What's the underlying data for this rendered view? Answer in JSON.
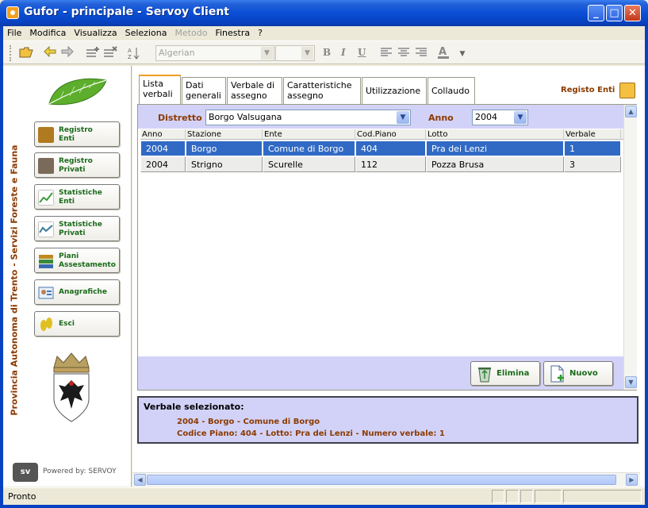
{
  "window": {
    "title": "Gufor - principale - Servoy Client",
    "min": "_",
    "max": "□",
    "close": "✕"
  },
  "menu": [
    "File",
    "Modifica",
    "Visualizza",
    "Seleziona",
    "Metodo",
    "Finestra",
    "?"
  ],
  "menu_disabled": [
    "Metodo"
  ],
  "toolbar": {
    "font_name": "Algerian",
    "bold": "B",
    "italic": "I",
    "underline": "U",
    "icons": [
      "open-folder-icon",
      "back-arrow-icon",
      "forward-arrow-icon",
      "add-record-icon",
      "delete-record-icon",
      "sort-icon"
    ]
  },
  "sidebar": {
    "org": "Provincia Autonoma di Trento - Servizi Foreste e Fauna",
    "items": [
      {
        "label": "Registro\nEnti",
        "l1": "Registro",
        "l2": "Enti",
        "color": "#b07a20"
      },
      {
        "label": "Registro\nPrivati",
        "l1": "Registro",
        "l2": "Privati",
        "color": "#7a6a5a"
      },
      {
        "label": "Statistiche\nEnti",
        "l1": "Statistiche",
        "l2": "Enti",
        "color": "#3a9a3a"
      },
      {
        "label": "Statistiche\nPrivati",
        "l1": "Statistiche",
        "l2": "Privati",
        "color": "#3a7a9a"
      },
      {
        "label": "Piani\nAssestamento",
        "l1": "Piani",
        "l2": "Assestamento",
        "color": "#c08a20"
      },
      {
        "label": "Anagrafiche",
        "l1": "Anagrafiche",
        "l2": "",
        "color": "#4a7ab0"
      },
      {
        "label": "Esci",
        "l1": "Esci",
        "l2": "",
        "color": "#e0c020"
      }
    ],
    "powered": "Powered by: SERVOY",
    "powered_logo": "sv"
  },
  "tabs": [
    {
      "l1": "Lista",
      "l2": "verbali"
    },
    {
      "l1": "Dati",
      "l2": "generali"
    },
    {
      "l1": "Verbale di",
      "l2": "assegno"
    },
    {
      "l1": "Caratteristiche",
      "l2": "assegno"
    },
    {
      "l1": "Utilizzazione",
      "l2": ""
    },
    {
      "l1": "Collaudo",
      "l2": ""
    }
  ],
  "registo_label": "Registo Enti",
  "filters": {
    "distretto_label": "Distretto",
    "distretto_value": "Borgo Valsugana",
    "anno_label": "Anno",
    "anno_value": "2004"
  },
  "table": {
    "columns": [
      "Anno",
      "Stazione",
      "Ente",
      "Cod.Piano",
      "Lotto",
      "Verbale"
    ],
    "rows": [
      [
        "2004",
        "Borgo",
        "Comune di Borgo",
        "404",
        "Pra dei Lenzi",
        "1"
      ],
      [
        "2004",
        "Strigno",
        "Scurelle",
        "112",
        "Pozza Brusa",
        "3"
      ]
    ],
    "selected_row": 0
  },
  "actions": {
    "delete": "Elimina",
    "new": "Nuovo"
  },
  "selection": {
    "title": "Verbale selezionato:",
    "line1": "2004 - Borgo - Comune di Borgo",
    "line2": "Codice Piano: 404 - Lotto: Pra dei Lenzi - Numero verbale: 1"
  },
  "status": "Pronto"
}
